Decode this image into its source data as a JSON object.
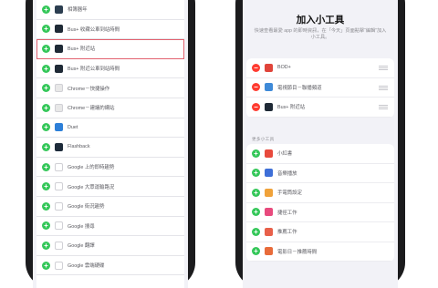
{
  "left_phone": {
    "rows": [
      {
        "label": "相簿器年",
        "icon": "album-icon",
        "icon_color": "#2c3e50",
        "highlighted": false
      },
      {
        "label": "Bus+ 收藏公車到站時間",
        "icon": "bus-plus-icon",
        "icon_color": "#1f2a36",
        "highlighted": false
      },
      {
        "label": "Bus+ 附近站",
        "icon": "bus-plus-icon",
        "icon_color": "#1f2a36",
        "highlighted": true
      },
      {
        "label": "Bus+ 附近公車到站時間",
        "icon": "bus-plus-icon",
        "icon_color": "#1f2a36",
        "highlighted": false
      },
      {
        "label": "Chrome－快捷操作",
        "icon": "chrome-icon",
        "icon_color": "#e8e8e8",
        "highlighted": false
      },
      {
        "label": "Chrome－建議的網站",
        "icon": "chrome-icon",
        "icon_color": "#e8e8e8",
        "highlighted": false
      },
      {
        "label": "Duet",
        "icon": "duet-icon",
        "icon_color": "#2d7fd8",
        "highlighted": false
      },
      {
        "label": "Flashback",
        "icon": "flashback-icon",
        "icon_color": "#1d2b3a",
        "highlighted": false
      },
      {
        "label": "Google 上的即時趨勢",
        "icon": "google-icon",
        "icon_color": "#ffffff",
        "highlighted": false
      },
      {
        "label": "Google 大眾運輸路況",
        "icon": "google-maps-icon",
        "icon_color": "#ffffff",
        "highlighted": false
      },
      {
        "label": "Google 街況趨勢",
        "icon": "google-maps-icon",
        "icon_color": "#ffffff",
        "highlighted": false
      },
      {
        "label": "Google 搜尋",
        "icon": "google-icon",
        "icon_color": "#ffffff",
        "highlighted": false
      },
      {
        "label": "Google 翻譯",
        "icon": "google-icon",
        "icon_color": "#ffffff",
        "highlighted": false
      },
      {
        "label": "Google 雲端硬碟",
        "icon": "google-drive-icon",
        "icon_color": "#ffffff",
        "highlighted": false
      }
    ]
  },
  "right_phone": {
    "title": "加入小工具",
    "description": "快速查看最愛 app 的即時資訊，在「今天」頁面點擊“編輯”加入小工具。",
    "active_widgets": [
      {
        "label": "BOD+",
        "icon": "app-icon",
        "icon_color": "#e0443a"
      },
      {
        "label": "電視節目－聯播頻道",
        "icon": "tv-icon",
        "icon_color": "#3e8ad8"
      },
      {
        "label": "Bus+ 附近站",
        "icon": "bus-plus-icon",
        "icon_color": "#1f2a36"
      }
    ],
    "more_header": "更多小工具",
    "more_widgets": [
      {
        "label": "小紅書",
        "icon": "app-icon",
        "icon_color": "#e84a3d"
      },
      {
        "label": "音樂播放",
        "icon": "music-icon",
        "icon_color": "#3e6fd8"
      },
      {
        "label": "手電筒設定",
        "icon": "flashlight-icon",
        "icon_color": "#f0a23a"
      },
      {
        "label": "捷徑工作",
        "icon": "shortcuts-icon",
        "icon_color": "#e84a7d"
      },
      {
        "label": "推薦工作",
        "icon": "shortcuts-icon",
        "icon_color": "#e8604a"
      },
      {
        "label": "電影日－推薦時間",
        "icon": "calendar-icon",
        "icon_color": "#e86b3a"
      }
    ]
  }
}
